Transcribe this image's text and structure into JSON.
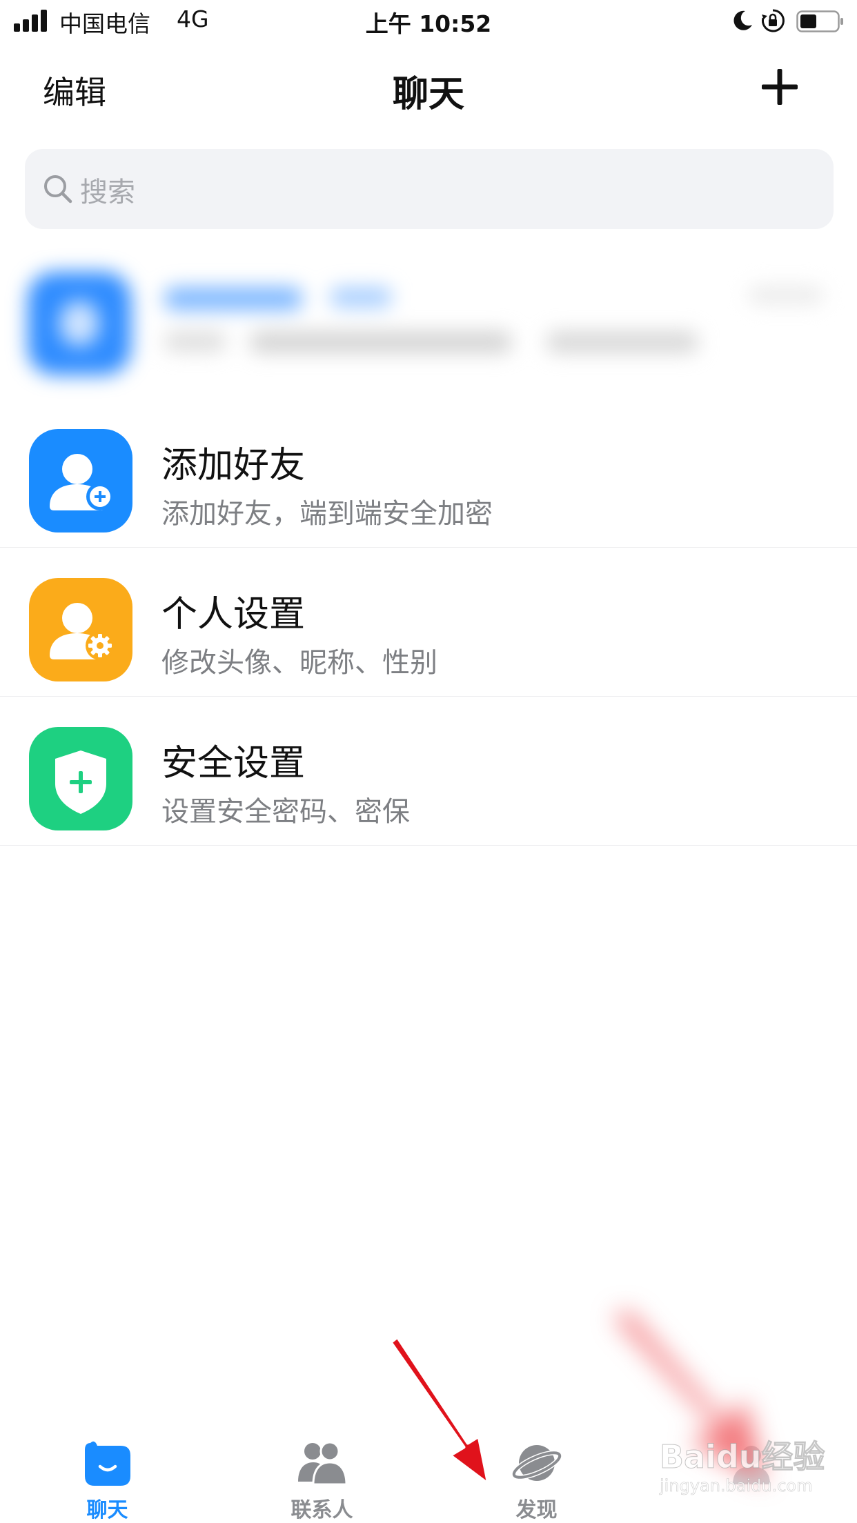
{
  "status_bar": {
    "carrier": "中国电信",
    "network": "4G",
    "time": "上午 10:52",
    "icons": [
      "signal-icon",
      "moon-icon",
      "orientation-lock-icon",
      "battery-icon"
    ]
  },
  "nav": {
    "edit_label": "编辑",
    "title": "聊天",
    "add_icon": "plus-icon"
  },
  "search": {
    "placeholder": "搜索",
    "icon": "search-icon"
  },
  "list": {
    "items": [
      {
        "title": "添加好友",
        "subtitle": "添加好友，端到端安全加密",
        "icon": "add-user-icon",
        "color": "#1a8cff"
      },
      {
        "title": "个人设置",
        "subtitle": "修改头像、昵称、性别",
        "icon": "user-settings-icon",
        "color": "#fbab1a"
      },
      {
        "title": "安全设置",
        "subtitle": "设置安全密码、密保",
        "icon": "shield-plus-icon",
        "color": "#1ed081"
      }
    ]
  },
  "tabs": [
    {
      "label": "聊天",
      "icon": "chat-bubble-icon",
      "active": true
    },
    {
      "label": "联系人",
      "icon": "contacts-icon",
      "active": false
    },
    {
      "label": "发现",
      "icon": "planet-icon",
      "active": false
    },
    {
      "label": "",
      "icon": "",
      "active": false
    }
  ],
  "watermark": {
    "main": "Baidu经验",
    "sub": "jingyan.baidu.com"
  },
  "colors": {
    "accent": "#1a8cff",
    "inactive_tab": "#8a8c90",
    "arrow": "#e0121b"
  }
}
